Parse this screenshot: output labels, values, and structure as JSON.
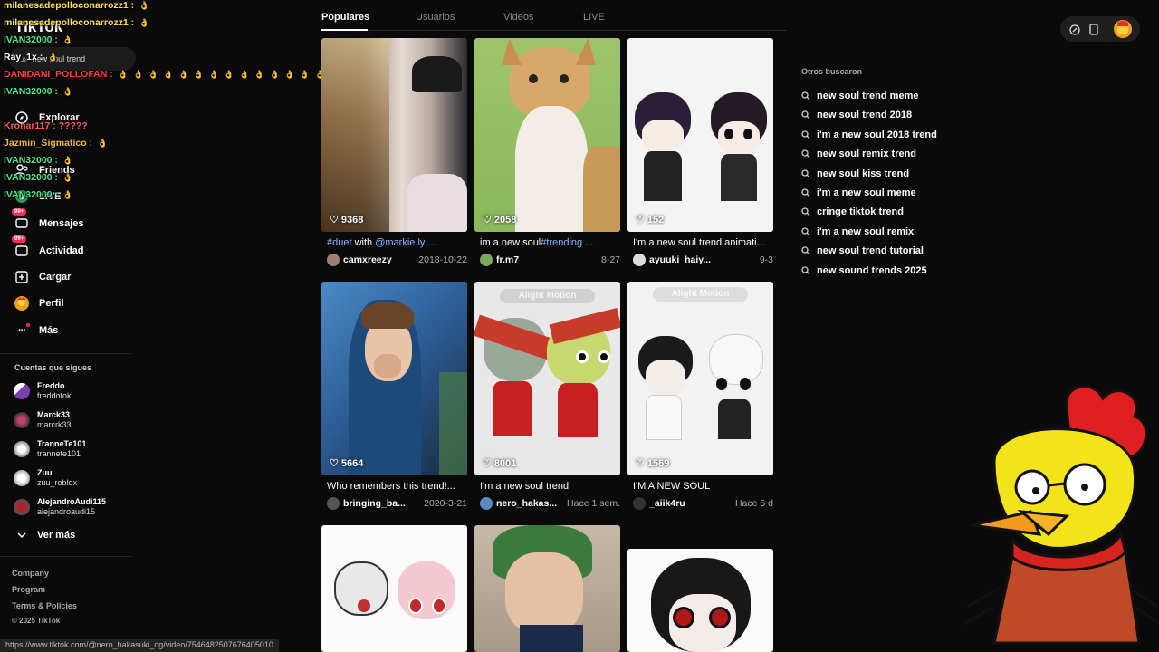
{
  "sidebar": {
    "logo": "TikTok",
    "search_label": "new soul trend",
    "nav": [
      {
        "label": "Explorar",
        "icon": "compass-icon"
      },
      {
        "label": "Friends",
        "icon": "friends-icon"
      },
      {
        "label": "LIVE",
        "icon": "live-icon"
      },
      {
        "label": "Mensajes",
        "icon": "message-icon",
        "badge": "99+"
      },
      {
        "label": "Actividad",
        "icon": "activity-icon",
        "badge": "99+"
      },
      {
        "label": "Cargar",
        "icon": "upload-icon"
      },
      {
        "label": "Perfil",
        "icon": "profile-icon"
      },
      {
        "label": "Más",
        "icon": "more-icon"
      }
    ],
    "following_title": "Cuentas que sigues",
    "following": [
      {
        "name": "Freddo",
        "handle": "freddotok"
      },
      {
        "name": "Marck33",
        "handle": "marcrk33"
      },
      {
        "name": "TranneTe101",
        "handle": "trannete101"
      },
      {
        "name": "Zuu",
        "handle": "zuu_roblox"
      },
      {
        "name": "AlejandroAudi115",
        "handle": "alejandroaudi15"
      }
    ],
    "see_more": "Ver más",
    "footer": [
      "Company",
      "Program",
      "Terms & Policies",
      "© 2025 TikTok"
    ]
  },
  "chat": [
    {
      "text": "milanesadepolloconarrozz1 :",
      "emotes": 1,
      "color": "#ffe14a"
    },
    {
      "text": "milanesadepolloconarrozz1 :",
      "emotes": 1,
      "color": "#ffe14a"
    },
    {
      "text": "IVAN32000 :",
      "emotes": 1,
      "color": "#4ae88a"
    },
    {
      "text": "Ray_1x :",
      "emotes": 1,
      "color": "#ffffff"
    },
    {
      "text": "DANIDANI_POLLOFAN :",
      "emotes": 14,
      "color": "#ff3d3d"
    },
    {
      "text": "IVAN32000 :",
      "emotes": 1,
      "color": "#4ae88a"
    },
    {
      "text": "Kronar117 : ?????",
      "emotes": 0,
      "color": "#ff5a5a"
    },
    {
      "text": "Jazmin_Sigmatico :",
      "emotes": 1,
      "color": "#f0b93a"
    },
    {
      "text": "IVAN32000 :",
      "emotes": 1,
      "color": "#4ae88a"
    },
    {
      "text": "IVAN32000 :",
      "emotes": 1,
      "color": "#4ae88a"
    },
    {
      "text": "IVAN32000 :",
      "emotes": 1,
      "color": "#4ae88a"
    }
  ],
  "tabs": [
    "Populares",
    "Usuarios",
    "Videos",
    "LIVE"
  ],
  "videos": [
    {
      "likes": "9368",
      "tag": "#duet",
      "title_mid": " with ",
      "tag2": "@markie.ly",
      "title_end": " ...",
      "user": "camxreezy",
      "date": "2018-10-22"
    },
    {
      "likes": "2058",
      "tag": "",
      "title_mid": "im a new soul",
      "tag2": "#trending",
      "title_end": " ...",
      "user": "fr.m7",
      "date": "8-27"
    },
    {
      "likes": "152",
      "tag": "",
      "title_mid": "I'm a new soul trend animati...",
      "tag2": "",
      "title_end": "",
      "user": "ayuuki_haiy...",
      "date": "9-3"
    },
    {
      "likes": "5664",
      "tag": "",
      "title_mid": "Who remembers this trend!...",
      "tag2": "",
      "title_end": "",
      "user": "bringing_ba...",
      "date": "2020-3-21"
    },
    {
      "likes": "8001",
      "tag": "",
      "title_mid": "I'm a new soul trend",
      "tag2": "",
      "title_end": "",
      "user": "nero_hakas...",
      "date": "Hace 1 sem."
    },
    {
      "likes": "1569",
      "tag": "",
      "title_mid": "I'M A NEW SOUL",
      "tag2": "",
      "title_end": "",
      "user": "_aiik4ru",
      "date": "Hace 5 d"
    }
  ],
  "watermark": "Alight Motion",
  "related": {
    "title": "Otros buscaron",
    "items": [
      "new soul trend meme",
      "new soul trend 2018",
      "i'm a new soul 2018 trend",
      "new soul remix trend",
      "new soul kiss trend",
      "i'm a new soul meme",
      "cringe tiktok trend",
      "i'm a new soul remix",
      "new soul trend tutorial",
      "new sound trends 2025"
    ]
  },
  "status_url": "https://www.tiktok.com/@nero_hakasuki_og/video/7546482507676405010",
  "colors": {
    "accent": "#fe2c55",
    "hashtag": "#8ab4ff",
    "background": "#0a0a0a"
  }
}
